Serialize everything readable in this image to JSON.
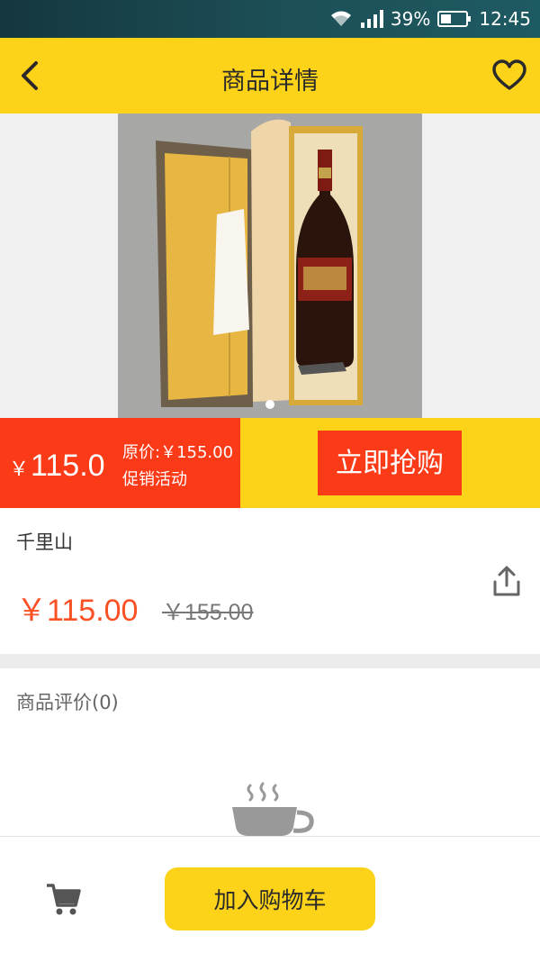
{
  "status_bar": {
    "battery": "39%",
    "time": "12:45"
  },
  "header": {
    "title": "商品详情"
  },
  "gallery": {
    "image_alt": "wine gift box"
  },
  "promo": {
    "currency": "￥",
    "price": "115.0",
    "original_price": "原价:￥155.00",
    "tag": "促销活动",
    "buy_label": "立即抢购"
  },
  "product": {
    "name": "千里山",
    "price": "￥115.00",
    "original_price": "￥155.00"
  },
  "reviews": {
    "title": "商品评价(0)"
  },
  "bottom": {
    "add_to_cart_label": "加入购物车"
  },
  "colors": {
    "accent_yellow": "#fdd319",
    "accent_red": "#fb3a17",
    "price_orange": "#fb5024"
  }
}
